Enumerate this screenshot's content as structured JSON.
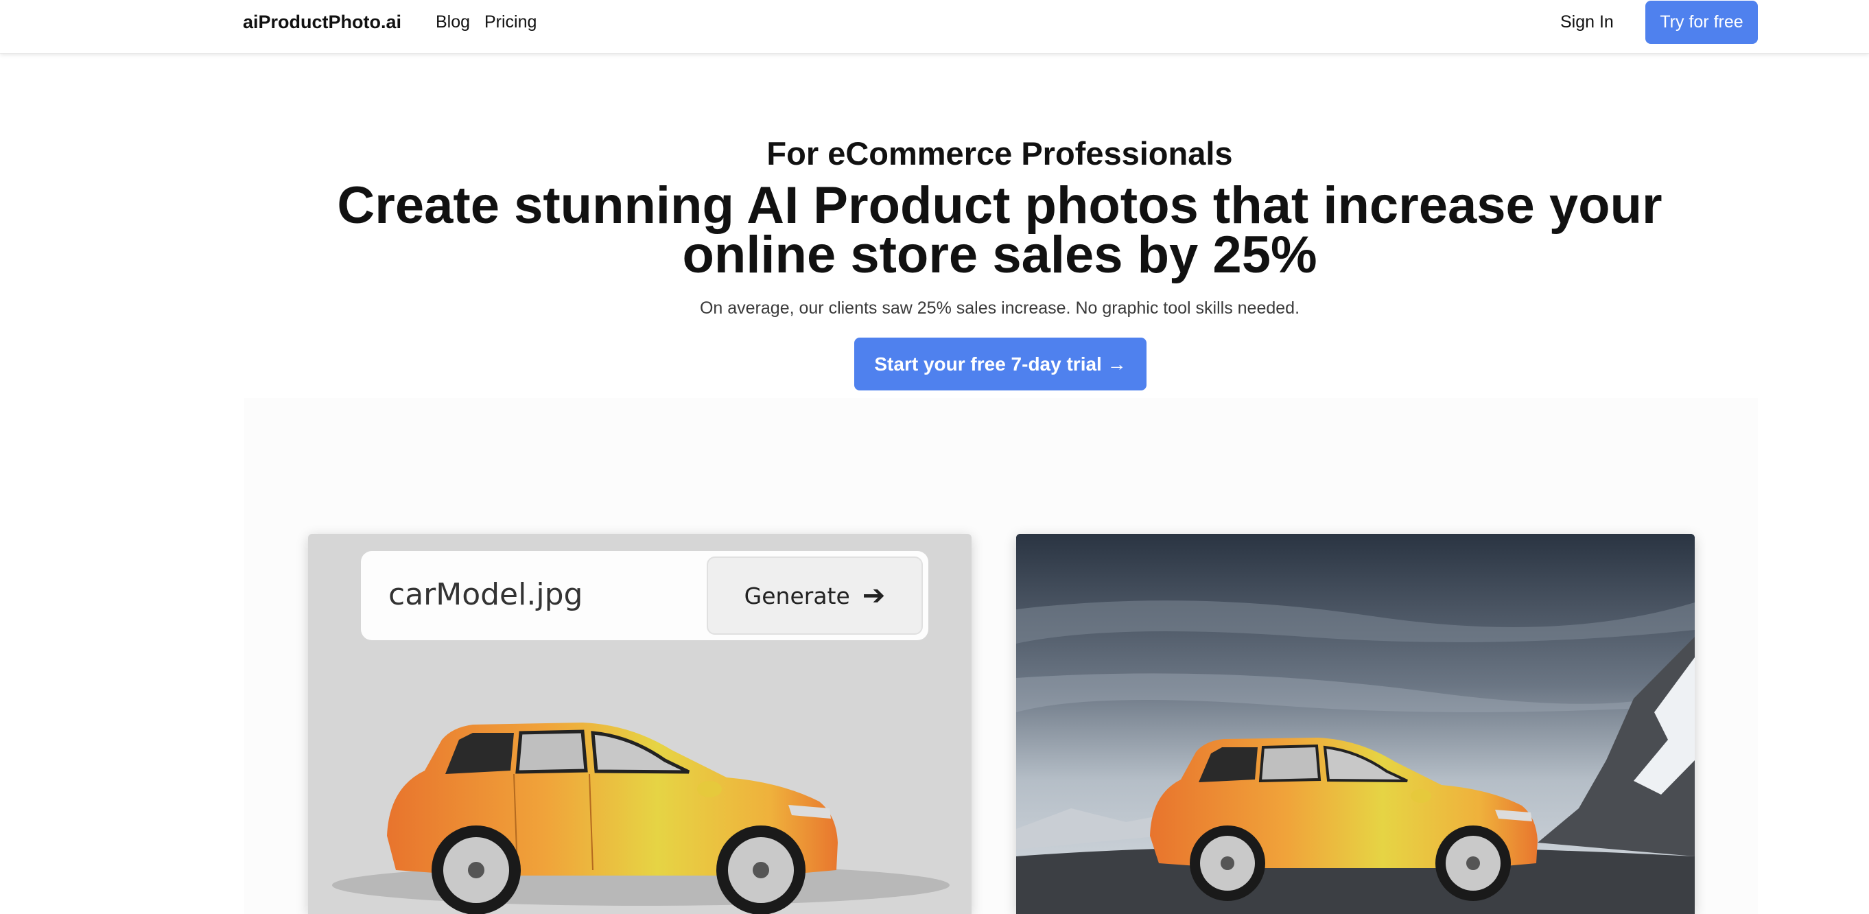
{
  "nav": {
    "logo": "aiProductPhoto.ai",
    "links": [
      {
        "label": "Blog"
      },
      {
        "label": "Pricing"
      }
    ],
    "sign_in": "Sign In",
    "try_free": "Try for free"
  },
  "hero": {
    "eyebrow": "For eCommerce Professionals",
    "headline": "Create stunning AI Product photos that increase your online store sales by 25%",
    "subtext": "On average, our clients saw 25% sales increase. No graphic tool skills needed.",
    "cta": "Start your free 7-day trial →"
  },
  "demo": {
    "file_name": "carModel.jpg",
    "generate_label": "Generate",
    "generate_icon": "arrow-right-icon",
    "input_image": "orange-yellow hatchback car on gray studio background",
    "output_image": "same car on mountain road with snowy peaks and cloudy sky"
  },
  "colors": {
    "accent": "#4f81ee",
    "panel_bg": "#d6d6d6"
  }
}
